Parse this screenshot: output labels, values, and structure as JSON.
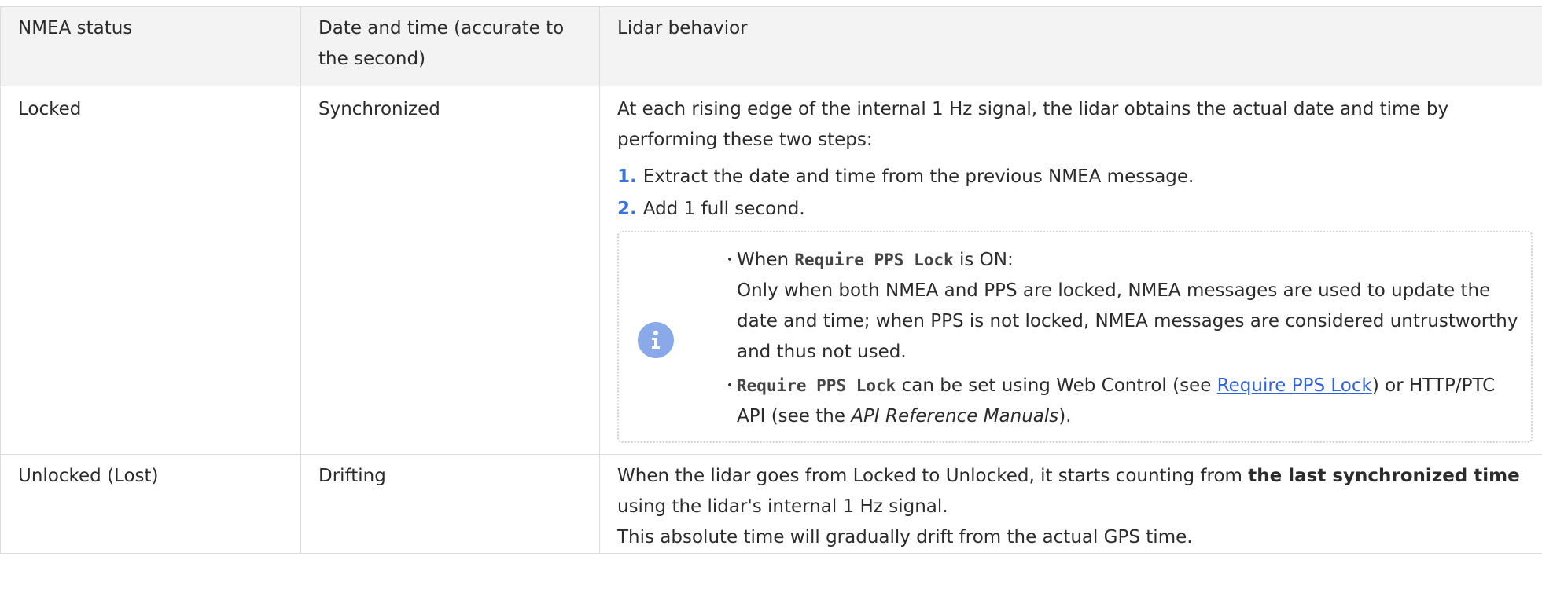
{
  "headers": {
    "col1": "NMEA status",
    "col2": "Date and time (accurate to the second)",
    "col3": "Lidar behavior"
  },
  "locked": {
    "status": "Locked",
    "datetime": "Synchronized",
    "intro": "At each rising edge of the internal 1 Hz signal, the lidar obtains the actual date and time by performing these two steps:",
    "steps": [
      {
        "num": "1.",
        "text": "Extract the date and time from the previous NMEA message."
      },
      {
        "num": "2.",
        "text": "Add 1 full second."
      }
    ],
    "note": {
      "icon": "info-icon",
      "bullet": "・",
      "item1_prefix": "When ",
      "item1_code": "Require PPS Lock",
      "item1_suffix": " is ON:",
      "item1_detail": "Only when both NMEA and PPS are locked, NMEA messages are used to update the date and time; when PPS is not locked, NMEA messages are considered untrustworthy and thus not used.",
      "item2_code": "Require PPS Lock",
      "item2_text1": " can be set using Web Control (see ",
      "item2_link": "Require PPS Lock",
      "item2_text2": ") or HTTP/PTC API (see the ",
      "item2_em": "API Reference Manuals",
      "item2_text3": ")."
    }
  },
  "unlocked": {
    "status": "Unlocked (Lost)",
    "datetime": "Drifting",
    "text1": "When the lidar goes from Locked to Unlocked, it starts counting from ",
    "bold": "the last synchronized time",
    "text2": " using the lidar's internal 1 Hz signal.",
    "line2": "This absolute time will gradually drift from the actual GPS time."
  }
}
